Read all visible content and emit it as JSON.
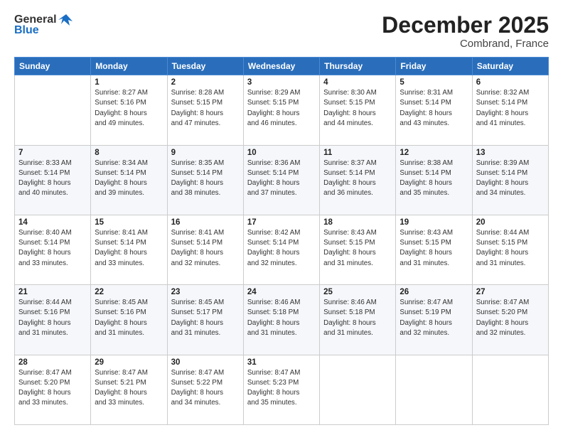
{
  "header": {
    "logo_general": "General",
    "logo_blue": "Blue",
    "title": "December 2025",
    "subtitle": "Combrand, France"
  },
  "columns": [
    "Sunday",
    "Monday",
    "Tuesday",
    "Wednesday",
    "Thursday",
    "Friday",
    "Saturday"
  ],
  "weeks": [
    [
      {
        "day": "",
        "content": ""
      },
      {
        "day": "1",
        "content": "Sunrise: 8:27 AM\nSunset: 5:16 PM\nDaylight: 8 hours\nand 49 minutes."
      },
      {
        "day": "2",
        "content": "Sunrise: 8:28 AM\nSunset: 5:15 PM\nDaylight: 8 hours\nand 47 minutes."
      },
      {
        "day": "3",
        "content": "Sunrise: 8:29 AM\nSunset: 5:15 PM\nDaylight: 8 hours\nand 46 minutes."
      },
      {
        "day": "4",
        "content": "Sunrise: 8:30 AM\nSunset: 5:15 PM\nDaylight: 8 hours\nand 44 minutes."
      },
      {
        "day": "5",
        "content": "Sunrise: 8:31 AM\nSunset: 5:14 PM\nDaylight: 8 hours\nand 43 minutes."
      },
      {
        "day": "6",
        "content": "Sunrise: 8:32 AM\nSunset: 5:14 PM\nDaylight: 8 hours\nand 41 minutes."
      }
    ],
    [
      {
        "day": "7",
        "content": "Sunrise: 8:33 AM\nSunset: 5:14 PM\nDaylight: 8 hours\nand 40 minutes."
      },
      {
        "day": "8",
        "content": "Sunrise: 8:34 AM\nSunset: 5:14 PM\nDaylight: 8 hours\nand 39 minutes."
      },
      {
        "day": "9",
        "content": "Sunrise: 8:35 AM\nSunset: 5:14 PM\nDaylight: 8 hours\nand 38 minutes."
      },
      {
        "day": "10",
        "content": "Sunrise: 8:36 AM\nSunset: 5:14 PM\nDaylight: 8 hours\nand 37 minutes."
      },
      {
        "day": "11",
        "content": "Sunrise: 8:37 AM\nSunset: 5:14 PM\nDaylight: 8 hours\nand 36 minutes."
      },
      {
        "day": "12",
        "content": "Sunrise: 8:38 AM\nSunset: 5:14 PM\nDaylight: 8 hours\nand 35 minutes."
      },
      {
        "day": "13",
        "content": "Sunrise: 8:39 AM\nSunset: 5:14 PM\nDaylight: 8 hours\nand 34 minutes."
      }
    ],
    [
      {
        "day": "14",
        "content": "Sunrise: 8:40 AM\nSunset: 5:14 PM\nDaylight: 8 hours\nand 33 minutes."
      },
      {
        "day": "15",
        "content": "Sunrise: 8:41 AM\nSunset: 5:14 PM\nDaylight: 8 hours\nand 33 minutes."
      },
      {
        "day": "16",
        "content": "Sunrise: 8:41 AM\nSunset: 5:14 PM\nDaylight: 8 hours\nand 32 minutes."
      },
      {
        "day": "17",
        "content": "Sunrise: 8:42 AM\nSunset: 5:14 PM\nDaylight: 8 hours\nand 32 minutes."
      },
      {
        "day": "18",
        "content": "Sunrise: 8:43 AM\nSunset: 5:15 PM\nDaylight: 8 hours\nand 31 minutes."
      },
      {
        "day": "19",
        "content": "Sunrise: 8:43 AM\nSunset: 5:15 PM\nDaylight: 8 hours\nand 31 minutes."
      },
      {
        "day": "20",
        "content": "Sunrise: 8:44 AM\nSunset: 5:15 PM\nDaylight: 8 hours\nand 31 minutes."
      }
    ],
    [
      {
        "day": "21",
        "content": "Sunrise: 8:44 AM\nSunset: 5:16 PM\nDaylight: 8 hours\nand 31 minutes."
      },
      {
        "day": "22",
        "content": "Sunrise: 8:45 AM\nSunset: 5:16 PM\nDaylight: 8 hours\nand 31 minutes."
      },
      {
        "day": "23",
        "content": "Sunrise: 8:45 AM\nSunset: 5:17 PM\nDaylight: 8 hours\nand 31 minutes."
      },
      {
        "day": "24",
        "content": "Sunrise: 8:46 AM\nSunset: 5:18 PM\nDaylight: 8 hours\nand 31 minutes."
      },
      {
        "day": "25",
        "content": "Sunrise: 8:46 AM\nSunset: 5:18 PM\nDaylight: 8 hours\nand 31 minutes."
      },
      {
        "day": "26",
        "content": "Sunrise: 8:47 AM\nSunset: 5:19 PM\nDaylight: 8 hours\nand 32 minutes."
      },
      {
        "day": "27",
        "content": "Sunrise: 8:47 AM\nSunset: 5:20 PM\nDaylight: 8 hours\nand 32 minutes."
      }
    ],
    [
      {
        "day": "28",
        "content": "Sunrise: 8:47 AM\nSunset: 5:20 PM\nDaylight: 8 hours\nand 33 minutes."
      },
      {
        "day": "29",
        "content": "Sunrise: 8:47 AM\nSunset: 5:21 PM\nDaylight: 8 hours\nand 33 minutes."
      },
      {
        "day": "30",
        "content": "Sunrise: 8:47 AM\nSunset: 5:22 PM\nDaylight: 8 hours\nand 34 minutes."
      },
      {
        "day": "31",
        "content": "Sunrise: 8:47 AM\nSunset: 5:23 PM\nDaylight: 8 hours\nand 35 minutes."
      },
      {
        "day": "",
        "content": ""
      },
      {
        "day": "",
        "content": ""
      },
      {
        "day": "",
        "content": ""
      }
    ]
  ]
}
